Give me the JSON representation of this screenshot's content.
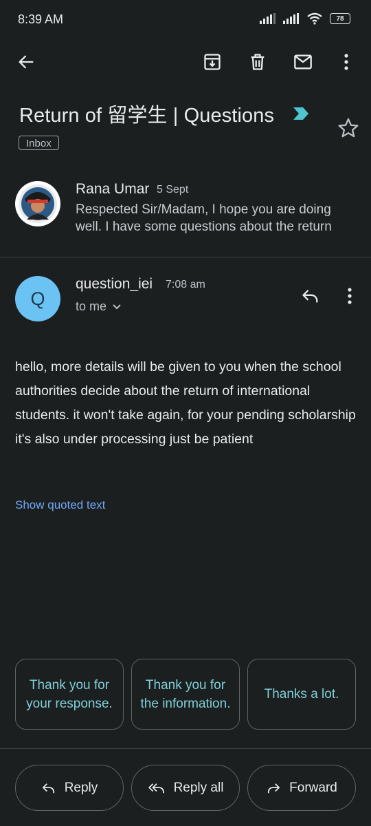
{
  "status": {
    "time": "8:39 AM",
    "battery": "78"
  },
  "toolbar": {
    "back_icon": "back-arrow-icon",
    "archive_icon": "archive-icon",
    "delete_icon": "trash-icon",
    "unread_icon": "mail-icon",
    "more_icon": "more-vert-icon"
  },
  "thread": {
    "subject": "Return of 留学生 | Questions",
    "label": "Inbox"
  },
  "message1": {
    "sender": "Rana Umar",
    "date": "5 Sept",
    "snippet": "Respected Sir/Madam, I hope you are doing well. I have some questions about the return"
  },
  "message2": {
    "avatar_letter": "Q",
    "sender": "question_iei",
    "time": "7:08 am",
    "to": "to me",
    "body": "hello, more details will be given to you when the school authorities decide about the return of international students. it won't take again, for your pending scholarship it's also under processing just be patient",
    "show_quoted": "Show quoted text"
  },
  "smart_replies": [
    "Thank you for your response.",
    "Thank you for the information.",
    "Thanks a lot."
  ],
  "actions": {
    "reply": "Reply",
    "reply_all": "Reply all",
    "forward": "Forward"
  },
  "colors": {
    "background": "#1c1f20",
    "accent_link": "#6ea7f5",
    "smart_reply_text": "#7fd0d8",
    "avatar_q": "#6bc3f4"
  }
}
